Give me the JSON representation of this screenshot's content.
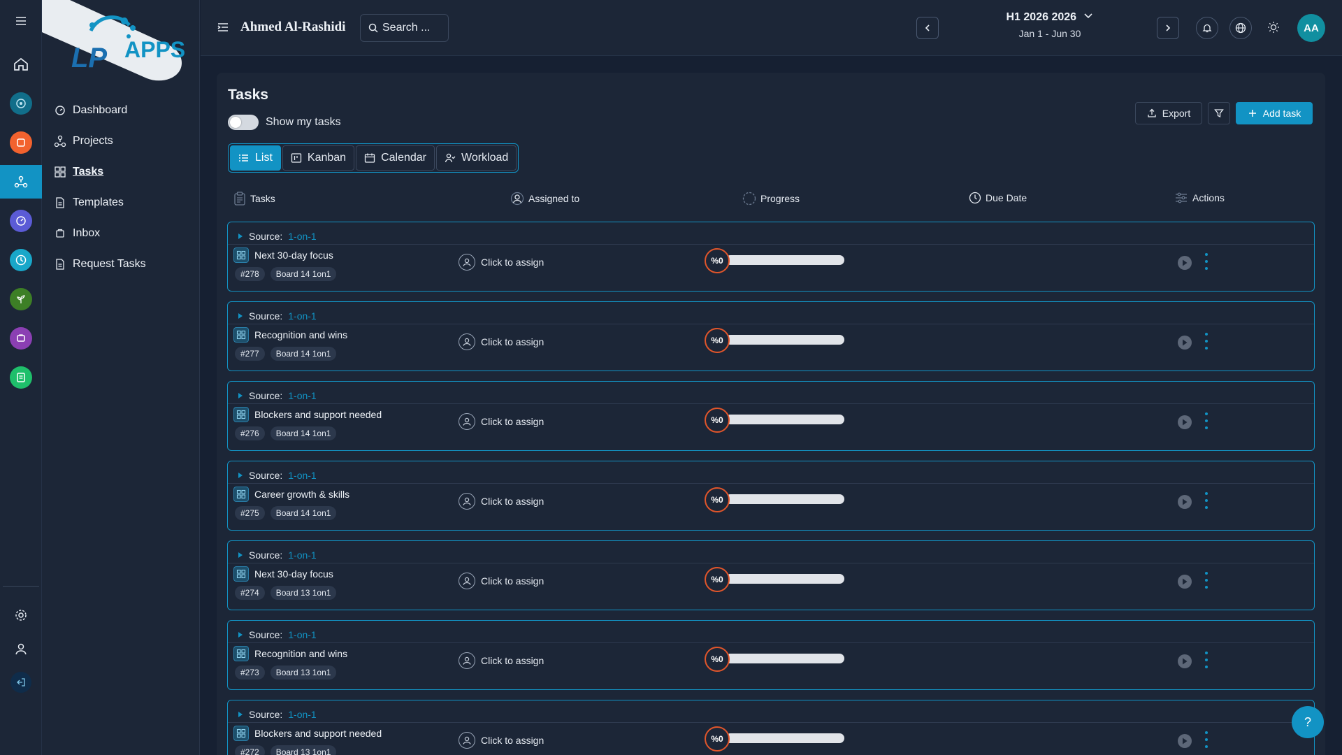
{
  "brand": {
    "logo_text": "APPS",
    "logo_letters": "LP"
  },
  "colors": {
    "accent": "#1293c4",
    "background": "#162032",
    "panel": "#1c2637",
    "progress_ring": "#e2562b"
  },
  "rail": {
    "items": [
      {
        "name": "home-icon"
      },
      {
        "name": "target-icon",
        "color": "#116e8a"
      },
      {
        "name": "orange-app-icon",
        "color": "#f2622e"
      },
      {
        "name": "tasks-app-icon",
        "active": true
      },
      {
        "name": "gauge-icon",
        "color": "#5b5bd6"
      },
      {
        "name": "clock-icon",
        "color": "#19a7c9"
      },
      {
        "name": "plant-icon",
        "color": "#3d7f26"
      },
      {
        "name": "purple-app-icon",
        "color": "#8b3fb3"
      },
      {
        "name": "green-app-icon",
        "color": "#1fbf6b"
      }
    ],
    "bottom": [
      {
        "name": "settings-icon"
      },
      {
        "name": "user-icon"
      },
      {
        "name": "logout-icon"
      }
    ]
  },
  "sidebar": {
    "items": [
      {
        "label": "Dashboard",
        "icon": "dashboard-icon"
      },
      {
        "label": "Projects",
        "icon": "projects-icon"
      },
      {
        "label": "Tasks",
        "icon": "tasks-icon",
        "active": true
      },
      {
        "label": "Templates",
        "icon": "file-icon"
      },
      {
        "label": "Inbox",
        "icon": "inbox-icon"
      },
      {
        "label": "Request Tasks",
        "icon": "file-icon"
      }
    ]
  },
  "header": {
    "user_name": "Ahmed Al-Rashidi",
    "search_placeholder": "Search ...",
    "period_title": "H1 2026 2026",
    "period_range": "Jan 1 - Jun 30",
    "avatar_initials": "AA"
  },
  "page": {
    "title": "Tasks",
    "show_my_tasks_label": "Show my tasks",
    "show_my_tasks_on": false,
    "views": [
      "List",
      "Kanban",
      "Calendar",
      "Workload"
    ],
    "active_view": "List",
    "export_label": "Export",
    "add_task_label": "Add task"
  },
  "columns": {
    "tasks": "Tasks",
    "assigned": "Assigned to",
    "progress": "Progress",
    "due": "Due Date",
    "actions": "Actions"
  },
  "tasks": [
    {
      "source_label": "Source:",
      "source": "1-on-1",
      "name": "Next 30-day focus",
      "id": "#278",
      "board": "Board 14 1on1",
      "assignee": "Click to assign",
      "progress_label": "%0",
      "progress": 0
    },
    {
      "source_label": "Source:",
      "source": "1-on-1",
      "name": "Recognition and wins",
      "id": "#277",
      "board": "Board 14 1on1",
      "assignee": "Click to assign",
      "progress_label": "%0",
      "progress": 0
    },
    {
      "source_label": "Source:",
      "source": "1-on-1",
      "name": "Blockers and support needed",
      "id": "#276",
      "board": "Board 14 1on1",
      "assignee": "Click to assign",
      "progress_label": "%0",
      "progress": 0
    },
    {
      "source_label": "Source:",
      "source": "1-on-1",
      "name": "Career growth & skills",
      "id": "#275",
      "board": "Board 14 1on1",
      "assignee": "Click to assign",
      "progress_label": "%0",
      "progress": 0
    },
    {
      "source_label": "Source:",
      "source": "1-on-1",
      "name": "Next 30-day focus",
      "id": "#274",
      "board": "Board 13 1on1",
      "assignee": "Click to assign",
      "progress_label": "%0",
      "progress": 0
    },
    {
      "source_label": "Source:",
      "source": "1-on-1",
      "name": "Recognition and wins",
      "id": "#273",
      "board": "Board 13 1on1",
      "assignee": "Click to assign",
      "progress_label": "%0",
      "progress": 0
    },
    {
      "source_label": "Source:",
      "source": "1-on-1",
      "name": "Blockers and support needed",
      "id": "#272",
      "board": "Board 13 1on1",
      "assignee": "Click to assign",
      "progress_label": "%0",
      "progress": 0
    }
  ],
  "help_label": "?"
}
